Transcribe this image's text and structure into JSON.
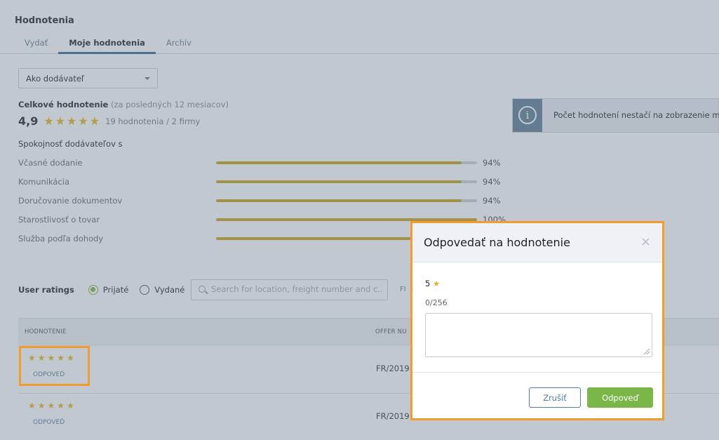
{
  "header": {
    "title": "Hodnotenia",
    "tabs": [
      {
        "label": "Vydať",
        "active": false
      },
      {
        "label": "Moje hodnotenia",
        "active": true
      },
      {
        "label": "Archív",
        "active": false
      }
    ]
  },
  "role_select": {
    "value": "Ako dodávateľ"
  },
  "overall": {
    "label": "Celkové hodnotenie",
    "period": "(za posledných 12 mesiacov)",
    "score": "4,9",
    "stars": "★★★★★",
    "count": "19 hodnotenia / 2 firmy"
  },
  "satisfaction": {
    "title": "Spokojnosť dodávateľov s",
    "metrics": [
      {
        "label": "Včasné dodanie",
        "percent": "94%",
        "value": 94
      },
      {
        "label": "Komunikácia",
        "percent": "94%",
        "value": 94
      },
      {
        "label": "Doručovanie dokumentov",
        "percent": "94%",
        "value": 94
      },
      {
        "label": "Starostlivosť o tovar",
        "percent": "100%",
        "value": 100
      },
      {
        "label": "Služba podľa dohody",
        "percent": "",
        "value": 100
      }
    ]
  },
  "info": {
    "text": "Počet hodnotení nestačí na zobrazenie mes",
    "icon": "info-icon"
  },
  "user_ratings": {
    "title": "User ratings",
    "radio_received": "Prijaté",
    "radio_given": "Vydané",
    "search_placeholder": "Search for location, freight number and c...",
    "filter_label": "FI"
  },
  "table": {
    "col_rating": "HODNOTENIE",
    "col_offer": "OFFER NU",
    "rows": [
      {
        "stars": "★★★★★",
        "reply": "ODPOVEĎ",
        "offer": "FR/2019"
      },
      {
        "stars": "★★★★★",
        "reply": "ODPOVEĎ",
        "offer": "FR/2019"
      }
    ]
  },
  "modal": {
    "title": "Odpovedať na hodnotenie",
    "close": "×",
    "rating": "5",
    "rating_star": "★",
    "char_count": "0/256",
    "cancel": "Zrušiť",
    "submit": "Odpoveď"
  },
  "colors": {
    "accent_orange": "#f39b2f",
    "star_gold": "#e8b21e",
    "bar_fill": "#c9a11a",
    "primary_green": "#7ab648",
    "link_blue": "#4e7fa8"
  }
}
